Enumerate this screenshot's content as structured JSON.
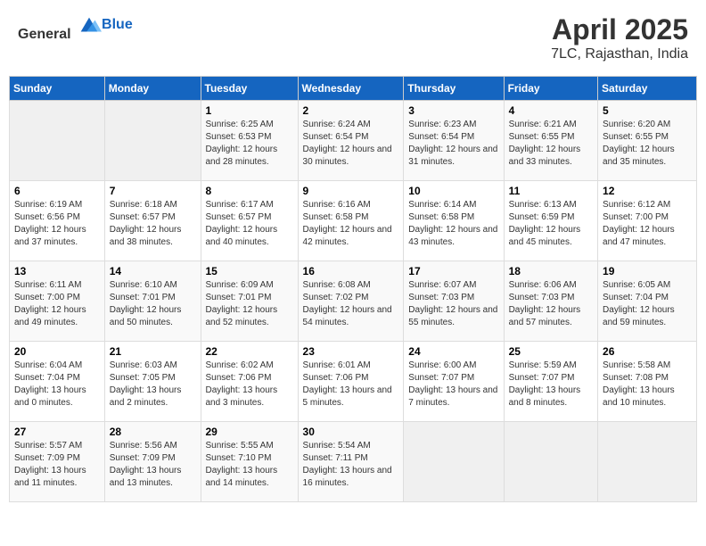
{
  "header": {
    "logo_general": "General",
    "logo_blue": "Blue",
    "title": "April 2025",
    "subtitle": "7LC, Rajasthan, India"
  },
  "weekdays": [
    "Sunday",
    "Monday",
    "Tuesday",
    "Wednesday",
    "Thursday",
    "Friday",
    "Saturday"
  ],
  "weeks": [
    [
      {
        "day": "",
        "sunrise": "",
        "sunset": "",
        "daylight": "",
        "empty": true
      },
      {
        "day": "",
        "sunrise": "",
        "sunset": "",
        "daylight": "",
        "empty": true
      },
      {
        "day": "1",
        "sunrise": "Sunrise: 6:25 AM",
        "sunset": "Sunset: 6:53 PM",
        "daylight": "Daylight: 12 hours and 28 minutes."
      },
      {
        "day": "2",
        "sunrise": "Sunrise: 6:24 AM",
        "sunset": "Sunset: 6:54 PM",
        "daylight": "Daylight: 12 hours and 30 minutes."
      },
      {
        "day": "3",
        "sunrise": "Sunrise: 6:23 AM",
        "sunset": "Sunset: 6:54 PM",
        "daylight": "Daylight: 12 hours and 31 minutes."
      },
      {
        "day": "4",
        "sunrise": "Sunrise: 6:21 AM",
        "sunset": "Sunset: 6:55 PM",
        "daylight": "Daylight: 12 hours and 33 minutes."
      },
      {
        "day": "5",
        "sunrise": "Sunrise: 6:20 AM",
        "sunset": "Sunset: 6:55 PM",
        "daylight": "Daylight: 12 hours and 35 minutes."
      }
    ],
    [
      {
        "day": "6",
        "sunrise": "Sunrise: 6:19 AM",
        "sunset": "Sunset: 6:56 PM",
        "daylight": "Daylight: 12 hours and 37 minutes."
      },
      {
        "day": "7",
        "sunrise": "Sunrise: 6:18 AM",
        "sunset": "Sunset: 6:57 PM",
        "daylight": "Daylight: 12 hours and 38 minutes."
      },
      {
        "day": "8",
        "sunrise": "Sunrise: 6:17 AM",
        "sunset": "Sunset: 6:57 PM",
        "daylight": "Daylight: 12 hours and 40 minutes."
      },
      {
        "day": "9",
        "sunrise": "Sunrise: 6:16 AM",
        "sunset": "Sunset: 6:58 PM",
        "daylight": "Daylight: 12 hours and 42 minutes."
      },
      {
        "day": "10",
        "sunrise": "Sunrise: 6:14 AM",
        "sunset": "Sunset: 6:58 PM",
        "daylight": "Daylight: 12 hours and 43 minutes."
      },
      {
        "day": "11",
        "sunrise": "Sunrise: 6:13 AM",
        "sunset": "Sunset: 6:59 PM",
        "daylight": "Daylight: 12 hours and 45 minutes."
      },
      {
        "day": "12",
        "sunrise": "Sunrise: 6:12 AM",
        "sunset": "Sunset: 7:00 PM",
        "daylight": "Daylight: 12 hours and 47 minutes."
      }
    ],
    [
      {
        "day": "13",
        "sunrise": "Sunrise: 6:11 AM",
        "sunset": "Sunset: 7:00 PM",
        "daylight": "Daylight: 12 hours and 49 minutes."
      },
      {
        "day": "14",
        "sunrise": "Sunrise: 6:10 AM",
        "sunset": "Sunset: 7:01 PM",
        "daylight": "Daylight: 12 hours and 50 minutes."
      },
      {
        "day": "15",
        "sunrise": "Sunrise: 6:09 AM",
        "sunset": "Sunset: 7:01 PM",
        "daylight": "Daylight: 12 hours and 52 minutes."
      },
      {
        "day": "16",
        "sunrise": "Sunrise: 6:08 AM",
        "sunset": "Sunset: 7:02 PM",
        "daylight": "Daylight: 12 hours and 54 minutes."
      },
      {
        "day": "17",
        "sunrise": "Sunrise: 6:07 AM",
        "sunset": "Sunset: 7:03 PM",
        "daylight": "Daylight: 12 hours and 55 minutes."
      },
      {
        "day": "18",
        "sunrise": "Sunrise: 6:06 AM",
        "sunset": "Sunset: 7:03 PM",
        "daylight": "Daylight: 12 hours and 57 minutes."
      },
      {
        "day": "19",
        "sunrise": "Sunrise: 6:05 AM",
        "sunset": "Sunset: 7:04 PM",
        "daylight": "Daylight: 12 hours and 59 minutes."
      }
    ],
    [
      {
        "day": "20",
        "sunrise": "Sunrise: 6:04 AM",
        "sunset": "Sunset: 7:04 PM",
        "daylight": "Daylight: 13 hours and 0 minutes."
      },
      {
        "day": "21",
        "sunrise": "Sunrise: 6:03 AM",
        "sunset": "Sunset: 7:05 PM",
        "daylight": "Daylight: 13 hours and 2 minutes."
      },
      {
        "day": "22",
        "sunrise": "Sunrise: 6:02 AM",
        "sunset": "Sunset: 7:06 PM",
        "daylight": "Daylight: 13 hours and 3 minutes."
      },
      {
        "day": "23",
        "sunrise": "Sunrise: 6:01 AM",
        "sunset": "Sunset: 7:06 PM",
        "daylight": "Daylight: 13 hours and 5 minutes."
      },
      {
        "day": "24",
        "sunrise": "Sunrise: 6:00 AM",
        "sunset": "Sunset: 7:07 PM",
        "daylight": "Daylight: 13 hours and 7 minutes."
      },
      {
        "day": "25",
        "sunrise": "Sunrise: 5:59 AM",
        "sunset": "Sunset: 7:07 PM",
        "daylight": "Daylight: 13 hours and 8 minutes."
      },
      {
        "day": "26",
        "sunrise": "Sunrise: 5:58 AM",
        "sunset": "Sunset: 7:08 PM",
        "daylight": "Daylight: 13 hours and 10 minutes."
      }
    ],
    [
      {
        "day": "27",
        "sunrise": "Sunrise: 5:57 AM",
        "sunset": "Sunset: 7:09 PM",
        "daylight": "Daylight: 13 hours and 11 minutes."
      },
      {
        "day": "28",
        "sunrise": "Sunrise: 5:56 AM",
        "sunset": "Sunset: 7:09 PM",
        "daylight": "Daylight: 13 hours and 13 minutes."
      },
      {
        "day": "29",
        "sunrise": "Sunrise: 5:55 AM",
        "sunset": "Sunset: 7:10 PM",
        "daylight": "Daylight: 13 hours and 14 minutes."
      },
      {
        "day": "30",
        "sunrise": "Sunrise: 5:54 AM",
        "sunset": "Sunset: 7:11 PM",
        "daylight": "Daylight: 13 hours and 16 minutes."
      },
      {
        "day": "",
        "sunrise": "",
        "sunset": "",
        "daylight": "",
        "empty": true
      },
      {
        "day": "",
        "sunrise": "",
        "sunset": "",
        "daylight": "",
        "empty": true
      },
      {
        "day": "",
        "sunrise": "",
        "sunset": "",
        "daylight": "",
        "empty": true
      }
    ]
  ]
}
